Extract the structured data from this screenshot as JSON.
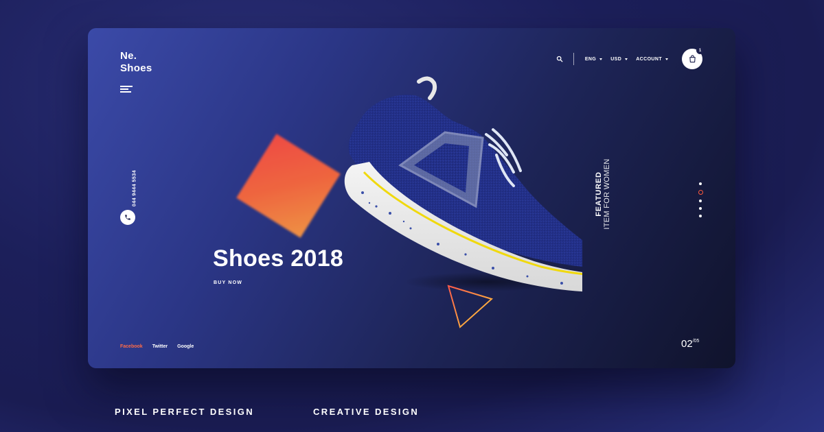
{
  "brand": {
    "line1": "Ne.",
    "line2": "Shoes"
  },
  "header": {
    "language": "ENG",
    "currency": "USD",
    "account": "ACCOUNT",
    "cart_count": "1"
  },
  "sidebar": {
    "phone": "044 9444 5534"
  },
  "hero": {
    "title": "Shoes 2018",
    "cta": "BUY NOW"
  },
  "featured": {
    "line1": "FEATURED",
    "line2": "ITEM FOR WOMEN"
  },
  "slider": {
    "current": "02",
    "total": "/05",
    "active_dot": 2
  },
  "social": {
    "facebook": "Facebook",
    "twitter": "Twitter",
    "google": "Google"
  },
  "captions": {
    "left": "PIXEL PERFECT DESIGN",
    "right": "CREATIVE DESIGN"
  },
  "colors": {
    "accent": "#ff6b47",
    "background": "#1c1f5a",
    "card_start": "#3b4aa8",
    "card_end": "#10132c"
  }
}
